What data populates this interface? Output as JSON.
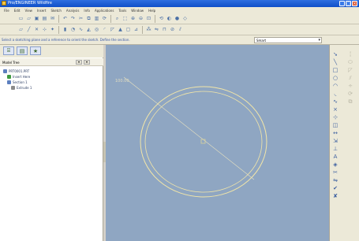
{
  "window": {
    "title": "Pro/ENGINEER Wildfire",
    "buttons": {
      "minimize": "_",
      "maximize": "□",
      "close": "×"
    }
  },
  "menubar": {
    "items": [
      "File",
      "Edit",
      "View",
      "Insert",
      "Sketch",
      "Analysis",
      "Info",
      "Applications",
      "Tools",
      "Window",
      "Help"
    ]
  },
  "toolbar_rows": [
    {
      "icons": [
        "new-icon",
        "open-icon",
        "save-icon",
        "print-icon",
        "email-icon",
        "undo-icon",
        "redo-icon",
        "cut-icon",
        "copy-icon",
        "paste-icon",
        "regenerate-icon",
        "find-icon",
        "select-icon",
        "zoom-in-icon",
        "zoom-out-icon",
        "refit-icon",
        "reorient-icon",
        "repaint-icon",
        "shading-icon",
        "wireframe-icon"
      ]
    },
    {
      "icons": [
        "datum-plane-icon",
        "datum-axis-icon",
        "datum-point-icon",
        "coordinate-system-icon",
        "spin-center-icon",
        "extrude-icon",
        "revolve-icon",
        "sweep-icon",
        "blend-icon",
        "hole-icon",
        "round-icon",
        "chamfer-icon",
        "rib-icon",
        "shell-icon",
        "draft-icon",
        "pattern-icon",
        "mirror-icon",
        "merge-icon",
        "trim-icon",
        "offset-icon"
      ]
    }
  ],
  "status": {
    "message": "Select a sketching plane and a reference to orient the sketch. Define the section.",
    "filter_value": "Smart"
  },
  "side_panel": {
    "tab_icons": [
      "model-tree-tab-icon",
      "folder-browser-tab-icon",
      "favorites-tab-icon"
    ],
    "tree_header": "Model Tree",
    "tree_nodes": [
      "PRT0001.PRT",
      "Insert Here",
      "Section 1",
      "Extrude 1"
    ]
  },
  "canvas": {
    "background": "#8fa6c2",
    "sketch_color": "#f2e6a8",
    "dimension_label": "100.00"
  },
  "sketch_toolbar": {
    "col1": [
      "select-arrow-icon",
      "line-icon",
      "rectangle-icon",
      "circle-icon",
      "arc-icon",
      "fillet-icon",
      "spline-icon",
      "point-icon",
      "coordinate-system-icon",
      "use-edge-icon",
      "dimension-icon",
      "modify-icon",
      "constraint-icon",
      "text-icon",
      "palette-icon",
      "trim-icon",
      "mirror-icon",
      "done-icon",
      "quit-icon"
    ],
    "col2": [
      "centerline-icon",
      "ellipse-icon",
      "chamfer-icon",
      "offset-icon",
      "divide-icon",
      "rotate-icon",
      "copy-icon"
    ]
  }
}
